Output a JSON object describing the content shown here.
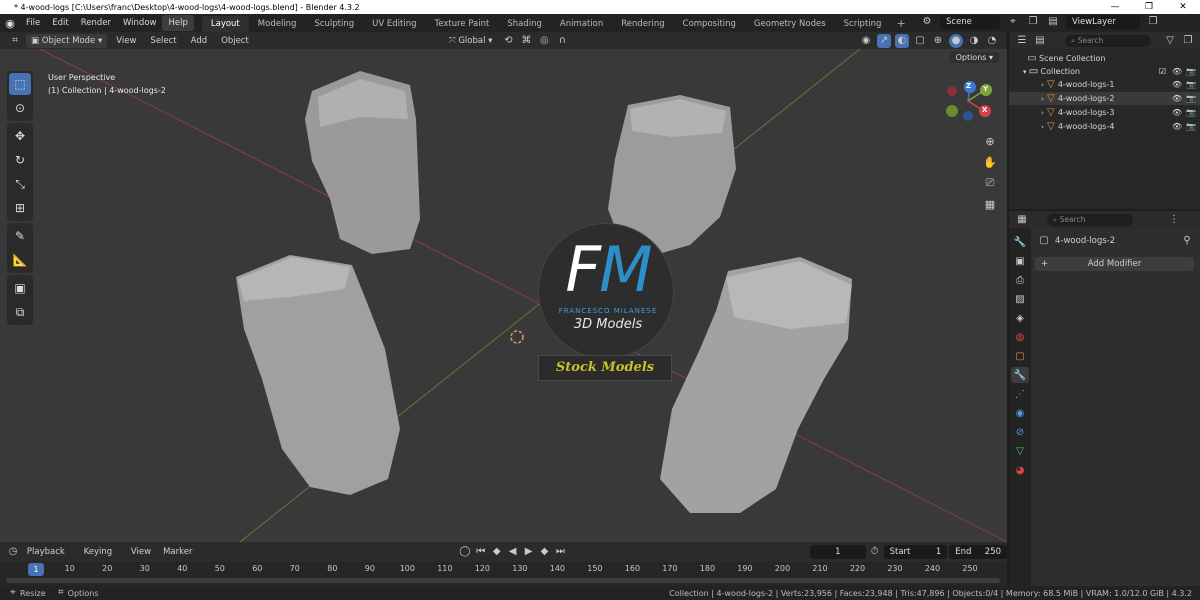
{
  "window": {
    "title": "* 4-wood-logs [C:\\Users\\franc\\Desktop\\4-wood-logs\\4-wood-logs.blend] - Blender 4.3.2",
    "controls": [
      "—",
      "❐",
      "✕"
    ]
  },
  "menus": [
    "File",
    "Edit",
    "Render",
    "Window",
    "Help"
  ],
  "workspaces": {
    "tabs": [
      "Layout",
      "Modeling",
      "Sculpting",
      "UV Editing",
      "Texture Paint",
      "Shading",
      "Animation",
      "Rendering",
      "Compositing",
      "Geometry Nodes",
      "Scripting"
    ],
    "active": "Layout",
    "add": "+"
  },
  "scene": {
    "name": "Scene",
    "view_layer": "ViewLayer"
  },
  "viewport": {
    "mode": "Object Mode",
    "menus": [
      "View",
      "Select",
      "Add",
      "Object"
    ],
    "orientation": "Global",
    "perspective_label": "User Perspective",
    "active_label": "(1) Collection | 4-wood-logs-2",
    "options_label": "Options",
    "gizmo": {
      "z": "Z",
      "y": "Y",
      "x": "X"
    }
  },
  "watermark": {
    "f": "F",
    "m": "M",
    "author": "FRANCESCO MILANESE",
    "subtitle": "3D Models",
    "badge": "Stock Models"
  },
  "timeline": {
    "menus": [
      "Playback",
      "Keying",
      "View",
      "Marker"
    ],
    "current_frame": "1",
    "start_label": "Start",
    "start": "1",
    "end_label": "End",
    "end": "250",
    "ticks": [
      "1",
      "10",
      "20",
      "30",
      "40",
      "50",
      "60",
      "70",
      "80",
      "90",
      "100",
      "110",
      "120",
      "130",
      "140",
      "150",
      "160",
      "170",
      "180",
      "190",
      "200",
      "210",
      "220",
      "230",
      "240",
      "250"
    ]
  },
  "status": {
    "left": [
      {
        "key": "Resize"
      },
      {
        "key": "Options"
      }
    ],
    "stats": "Collection | 4-wood-logs-2 | Verts:23,956 | Faces:23,948 | Tris:47,896 | Objects:0/4 | Memory: 68.5 MiB | VRAM: 1.0/12.0 GiB | 4.3.2"
  },
  "outliner": {
    "search_placeholder": "Search",
    "root": "Scene Collection",
    "collection": "Collection",
    "objects": [
      "4-wood-logs-1",
      "4-wood-logs-2",
      "4-wood-logs-3",
      "4-wood-logs-4"
    ],
    "selected": "4-wood-logs-2"
  },
  "properties": {
    "search_placeholder": "Search",
    "object_name": "4-wood-logs-2",
    "add_modifier": "Add Modifier"
  },
  "colors": {
    "accent": "#4772b3",
    "x_axis": "#d2424d",
    "y_axis": "#7ea43a",
    "z_axis": "#3f78d6",
    "brand_blue": "#2e8ec8",
    "stock_yellow": "#c8c22a"
  }
}
